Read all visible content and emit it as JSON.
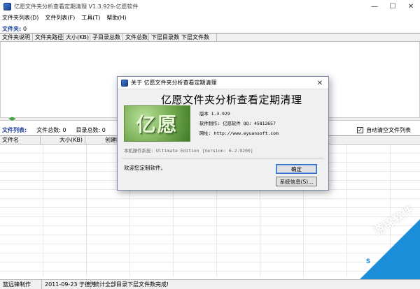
{
  "window": {
    "title": "亿愿文件夹分析查看定期清理 V1.3.929-亿愿软件",
    "controls": [
      "—",
      "☐",
      "✕"
    ]
  },
  "menu": [
    "文件夹列表(D)",
    "文件列表(F)",
    "工具(T)",
    "帮助(H)"
  ],
  "folders": {
    "label": "文件夹:",
    "count": "0",
    "columns": [
      "文件夹说明",
      "文件夹路径",
      "大小(KB)",
      "子目录总数",
      "文件总数",
      "下层目录数",
      "下层文件数"
    ]
  },
  "files": {
    "label": "文件列表:",
    "stats": [
      "文件总数: 0",
      "目录总数: 0"
    ],
    "columns": [
      "文件名",
      "大小(KB)",
      "创建时"
    ],
    "auto_clear_label": "自动清空文件列表",
    "auto_clear_checked": true
  },
  "status": {
    "cells": [
      "篮远锋制作",
      "2011-09-23 于德芳",
      "统计全部目录下层文件数完成!"
    ]
  },
  "dialog": {
    "title": "关于 亿愿文件夹分析查看定期清理",
    "close": "✕",
    "heading": "亿愿文件夹分析查看定期清理",
    "logo_text": "亿愿",
    "version": "版本 1.3.929",
    "author": "软件制作: 亿愿软件 QQ: 45812657",
    "website": "网址: http://www.eyuansoft.com",
    "system": "本机操作系统: Ultimate Edition [Version: 6.2.9200]",
    "thanks": "欢迎您定制软件。",
    "ok_label": "确定",
    "sysinfo_label": "系统信息(S)..."
  },
  "watermark": {
    "text": "游锦软件",
    "badge": "S"
  }
}
